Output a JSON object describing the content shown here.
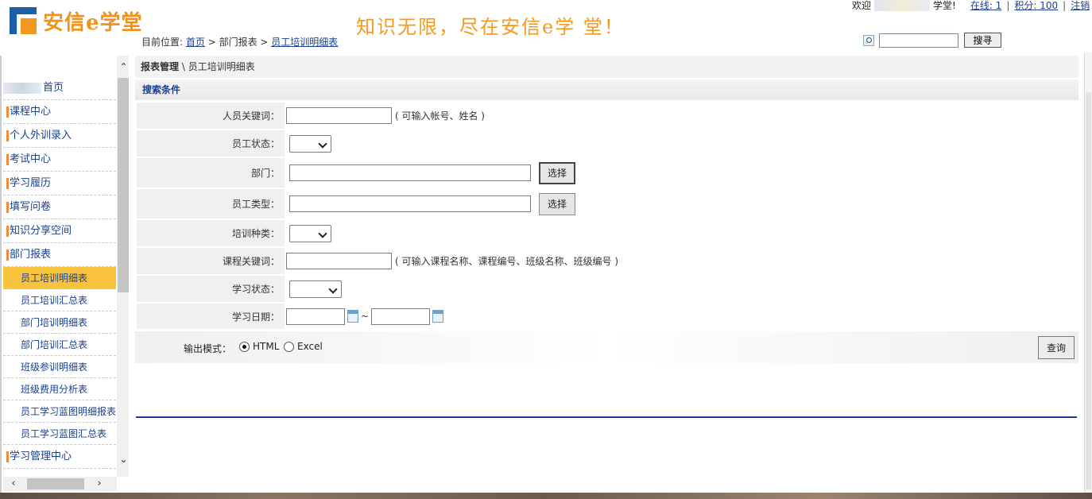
{
  "header": {
    "logo_text": "安信e学堂",
    "slogan": "知识无限，尽在安信e学   堂！",
    "welcome_prefix": "欢迎",
    "welcome_suffix": "学堂!",
    "online": "在线: 1",
    "points": "积分: 100",
    "logout": "注销",
    "breadcrumb": {
      "prefix": "目前位置: ",
      "home": "首页",
      "sep1": " > ",
      "section": "部门报表",
      "sep2": " > ",
      "current": "员工培训明细表"
    },
    "search_button": "搜寻",
    "search_value": ""
  },
  "sidebar": {
    "top_item": "首页",
    "items": [
      "课程中心",
      "个人外训录入",
      "考试中心",
      "学习履历",
      "填写问卷",
      "知识分享空间",
      "部门报表"
    ],
    "sub_items": [
      "员工培训明细表",
      "员工培训汇总表",
      "部门培训明细表",
      "部门培训汇总表",
      "班级参训明细表",
      "班级费用分析表",
      "员工学习蓝图明细报表",
      "员工学习蓝图汇总表"
    ],
    "active_sub": "员工培训明细表",
    "bottom_item": "学习管理中心"
  },
  "main": {
    "panel_title_bold": "报表管理",
    "panel_title_rest": " \\ 员工培训明细表",
    "conditions_title": "搜索条件",
    "fields": {
      "keyword_label": "人员关键词：",
      "keyword_hint": "( 可输入帐号、姓名 )",
      "status_label": "员工状态：",
      "dept_label": "部门：",
      "dept_button": "选择",
      "type_label": "员工类型：",
      "type_button": "选择",
      "train_kind_label": "培训种类：",
      "course_keyword_label": "课程关键词：",
      "course_keyword_hint": "( 可输入课程名称、课程编号、班级名称、班级编号 )",
      "study_status_label": "学习状态：",
      "study_date_label": "学习日期：",
      "date_sep": "~"
    },
    "output": {
      "label": "输出模式：",
      "html": "HTML",
      "excel": "Excel",
      "selected": "HTML"
    },
    "query_button": "查询"
  }
}
